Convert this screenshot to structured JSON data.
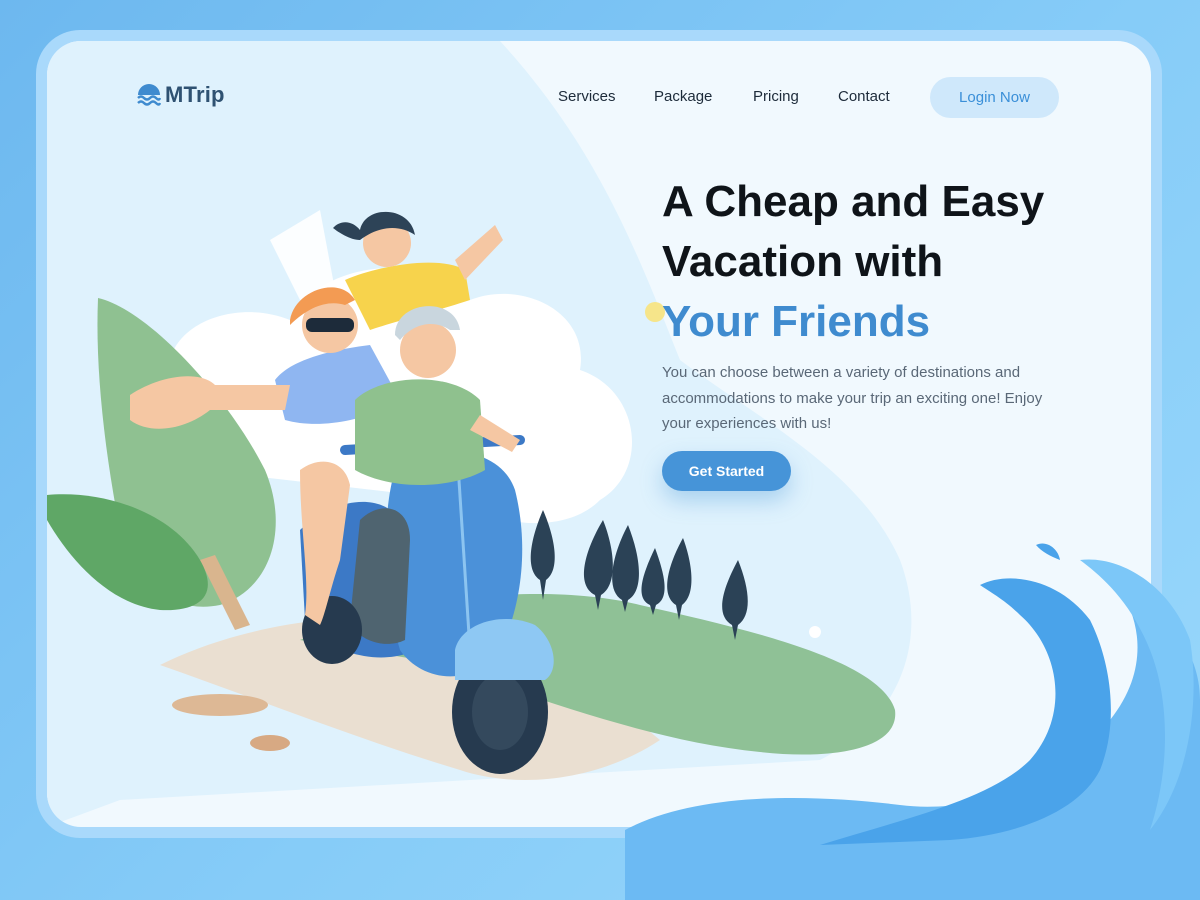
{
  "brand": {
    "name": "MTrip",
    "logo_icon": "wave-icon"
  },
  "nav": {
    "items": [
      {
        "label": "Services"
      },
      {
        "label": "Package"
      },
      {
        "label": "Pricing"
      },
      {
        "label": "Contact"
      }
    ],
    "login_label": "Login Now"
  },
  "hero": {
    "title_line1": "A Cheap and Easy",
    "title_line2": "Vacation with",
    "title_accent": "Your Friends",
    "description": "You can choose between a variety of destinations and accommodations to make your trip an exciting one! Enjoy your experiences with us!",
    "cta_label": "Get Started"
  },
  "colors": {
    "accent": "#3f8bcf",
    "button": "#4694d8",
    "login_bg": "#cfe8fb",
    "background": "#7cc3f4"
  }
}
